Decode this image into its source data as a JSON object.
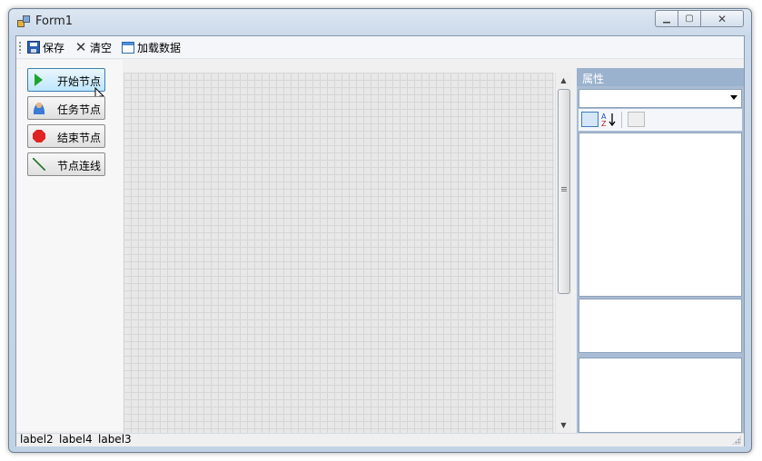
{
  "window": {
    "title": "Form1"
  },
  "toolbar": {
    "save_label": "保存",
    "clear_label": "清空",
    "load_label": "加载数据"
  },
  "nodes": {
    "start": "开始节点",
    "task": "任务节点",
    "end": "结束节点",
    "link": "节点连线"
  },
  "properties": {
    "title": "属性",
    "combo_value": ""
  },
  "status": {
    "label2": "label2",
    "label4": "label4",
    "label3": "label3"
  },
  "colors": {
    "prop_header": "#9bb2ce",
    "grid_bg": "#e8e8e8",
    "start_icon": "#1fa431",
    "end_icon": "#e02424"
  }
}
